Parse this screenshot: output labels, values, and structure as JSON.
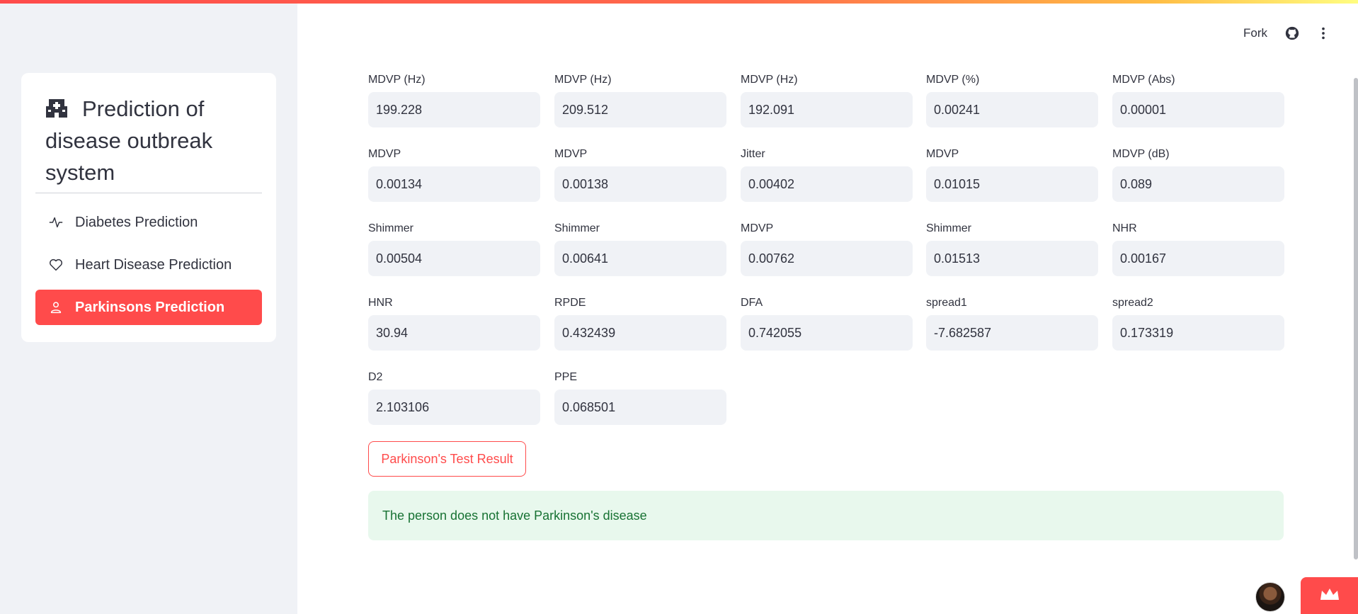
{
  "sidebar": {
    "title": "Prediction of disease outbreak system",
    "items": [
      {
        "label": "Diabetes Prediction",
        "icon": "activity-icon",
        "active": false
      },
      {
        "label": "Heart Disease Prediction",
        "icon": "heart-icon",
        "active": false
      },
      {
        "label": "Parkinsons Prediction",
        "icon": "person-icon",
        "active": true
      }
    ]
  },
  "header": {
    "fork_label": "Fork",
    "icons": [
      "github-icon",
      "more-vertical-icon"
    ]
  },
  "fields": [
    {
      "label": "MDVP (Hz)",
      "value": "199.228"
    },
    {
      "label": "MDVP (Hz)",
      "value": "209.512"
    },
    {
      "label": "MDVP (Hz)",
      "value": "192.091"
    },
    {
      "label": "MDVP (%)",
      "value": "0.00241"
    },
    {
      "label": "MDVP (Abs)",
      "value": "0.00001"
    },
    {
      "label": "MDVP",
      "value": "0.00134"
    },
    {
      "label": "MDVP",
      "value": "0.00138"
    },
    {
      "label": "Jitter",
      "value": "0.00402"
    },
    {
      "label": "MDVP",
      "value": "0.01015"
    },
    {
      "label": "MDVP (dB)",
      "value": "0.089"
    },
    {
      "label": "Shimmer",
      "value": "0.00504"
    },
    {
      "label": "Shimmer",
      "value": "0.00641"
    },
    {
      "label": "MDVP",
      "value": "0.00762"
    },
    {
      "label": "Shimmer",
      "value": "0.01513"
    },
    {
      "label": "NHR",
      "value": "0.00167"
    },
    {
      "label": "HNR",
      "value": "30.94"
    },
    {
      "label": "RPDE",
      "value": "0.432439"
    },
    {
      "label": "DFA",
      "value": "0.742055"
    },
    {
      "label": "spread1",
      "value": "-7.682587"
    },
    {
      "label": "spread2",
      "value": "0.173319"
    },
    {
      "label": "D2",
      "value": "2.103106"
    },
    {
      "label": "PPE",
      "value": "0.068501"
    }
  ],
  "result_button_label": "Parkinson's Test Result",
  "result_message": "The person does not have Parkinson's disease",
  "colors": {
    "accent": "#ff4b4b",
    "sidebar_bg": "#f0f2f6",
    "success_bg": "#e8f8ed",
    "success_text": "#177233"
  }
}
